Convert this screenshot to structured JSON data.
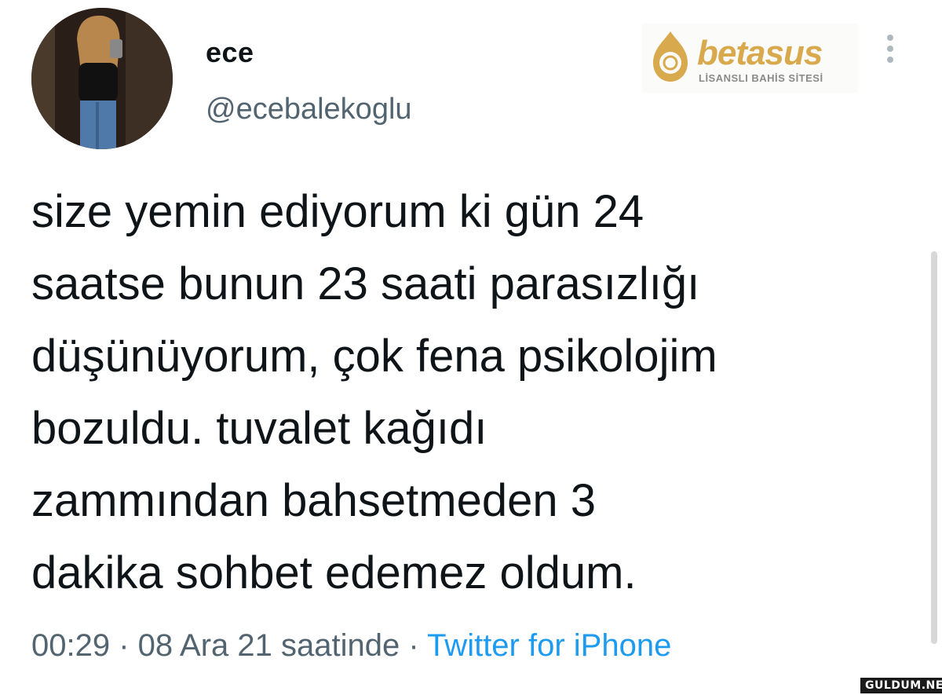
{
  "author": {
    "display_name": "ece",
    "handle": "@ecebalekoglu",
    "avatar_icon": "profile-photo"
  },
  "ad_logo": {
    "brand": "betasus",
    "tagline": "LİSANSLI BAHİS SİTESİ",
    "accent_color": "#d9a94e",
    "icon": "betasus-logo-icon"
  },
  "tweet": {
    "lines": [
      "size yemin ediyorum ki gün 24",
      "saatse bunun 23 saati parasızlığı",
      "düşünüyorum, çok fena psikolojim",
      "bozuldu. tuvalet kağıdı",
      "zammından bahsetmeden 3",
      "dakika sohbet edemez oldum."
    ]
  },
  "meta": {
    "time": "00:29",
    "separator": " · ",
    "date": "08 Ara 21 saatinde",
    "source": "Twitter for iPhone",
    "source_color": "#1d9bf0"
  },
  "menu": {
    "icon": "more-vertical-icon"
  },
  "watermark": {
    "text": "GULDUM.NET"
  }
}
